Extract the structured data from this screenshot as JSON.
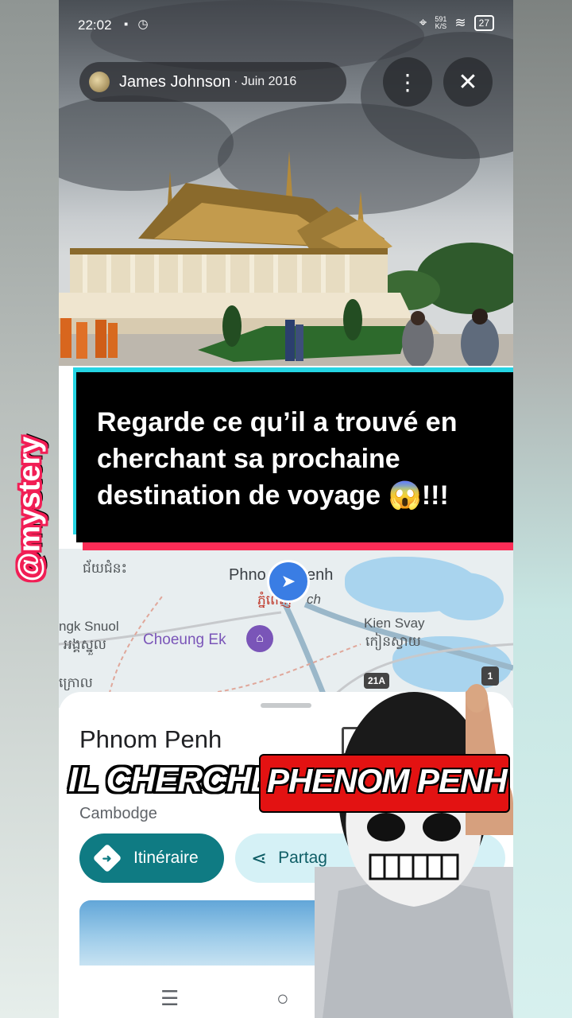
{
  "status_bar": {
    "time": "22:02",
    "left_icons": "▪ ◷",
    "speed_value": "591",
    "speed_unit": "K/S",
    "battery": "27"
  },
  "photo_header": {
    "author": "James Johnson",
    "date": "· Juin 2016",
    "more_icon": "⋮",
    "close_icon": "✕"
  },
  "banner": {
    "text": "Regarde ce qu’il a trouvé en cherchant sa prochaine destination de voyage 😱!!!"
  },
  "map": {
    "label_top_left": "ជ័យជំនះ",
    "city_prefix": "Phno",
    "city_suffix": "enh",
    "city_khmer": "ភ្នំពេញ",
    "city_khmer_suffix": "ch",
    "label_snuol": "ngk Snuol",
    "label_snuol_khmer": "អង្គស្នួល",
    "choeung_ek": "Choeung Ek",
    "kien_svay": "Kien Svay",
    "kien_svay_khmer": "កៀនស្វាយ",
    "label_bottom_left": "ក្រោល",
    "route_21a": "21A",
    "route_1": "1"
  },
  "place_sheet": {
    "name": "Phnom Penh",
    "country": "Cambodge",
    "route_button": "Itinéraire",
    "share_button": "Partag",
    "extra_button": "str"
  },
  "overlay": {
    "prefix": "IL CHERCHE",
    "highlight": "PHENOM PENH"
  },
  "watermark": "@mystery",
  "nav": {
    "menu": "☰",
    "home": "○"
  }
}
